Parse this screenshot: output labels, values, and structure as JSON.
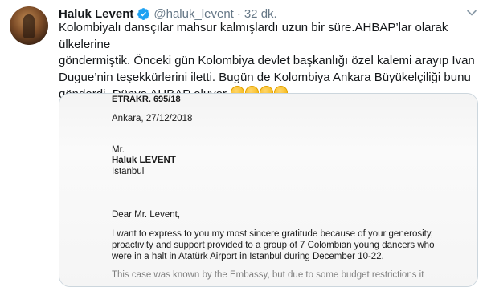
{
  "tweet": {
    "author_name": "Haluk Levent",
    "handle": "@haluk_levent",
    "separator": "·",
    "time": "32 dk.",
    "text": "Kolombiyalı dansçılar mahsur kalmışlardı uzun bir süre.AHBAP’lar olarak ülkelerine\ngöndermiştik. Önceki gün Kolombiya devlet başkanlığı özel kalemi arayıp Ivan\nDugue’nin teşekkürlerini iletti. Bugün de Kolombiya Ankara Büyükelçiliği bunu\ngönderdi. Dünya AHBAP oluyor ",
    "emoji_count": 4,
    "colors": {
      "name": "#14171a",
      "secondary": "#657786",
      "verified": "#1da1f2",
      "border": "#ccd6dd"
    }
  },
  "letter": {
    "reference": "ETRAKR. 695/18",
    "date_line": "Ankara, 27/12/2018",
    "recipient_title": "Mr.",
    "recipient_name": "Haluk LEVENT",
    "recipient_city": "Istanbul",
    "salutation": "Dear Mr. Levent,",
    "body_lines": [
      "I want to express to you my most sincere gratitude because of your generosity,",
      "proactivity and support provided to a group of 7 Colombian young dancers who",
      "were in a halt in Atatürk Airport in Istanbul during December 10-22."
    ],
    "cut_line": "This case was known by the Embassy, but due to some budget restrictions it"
  }
}
